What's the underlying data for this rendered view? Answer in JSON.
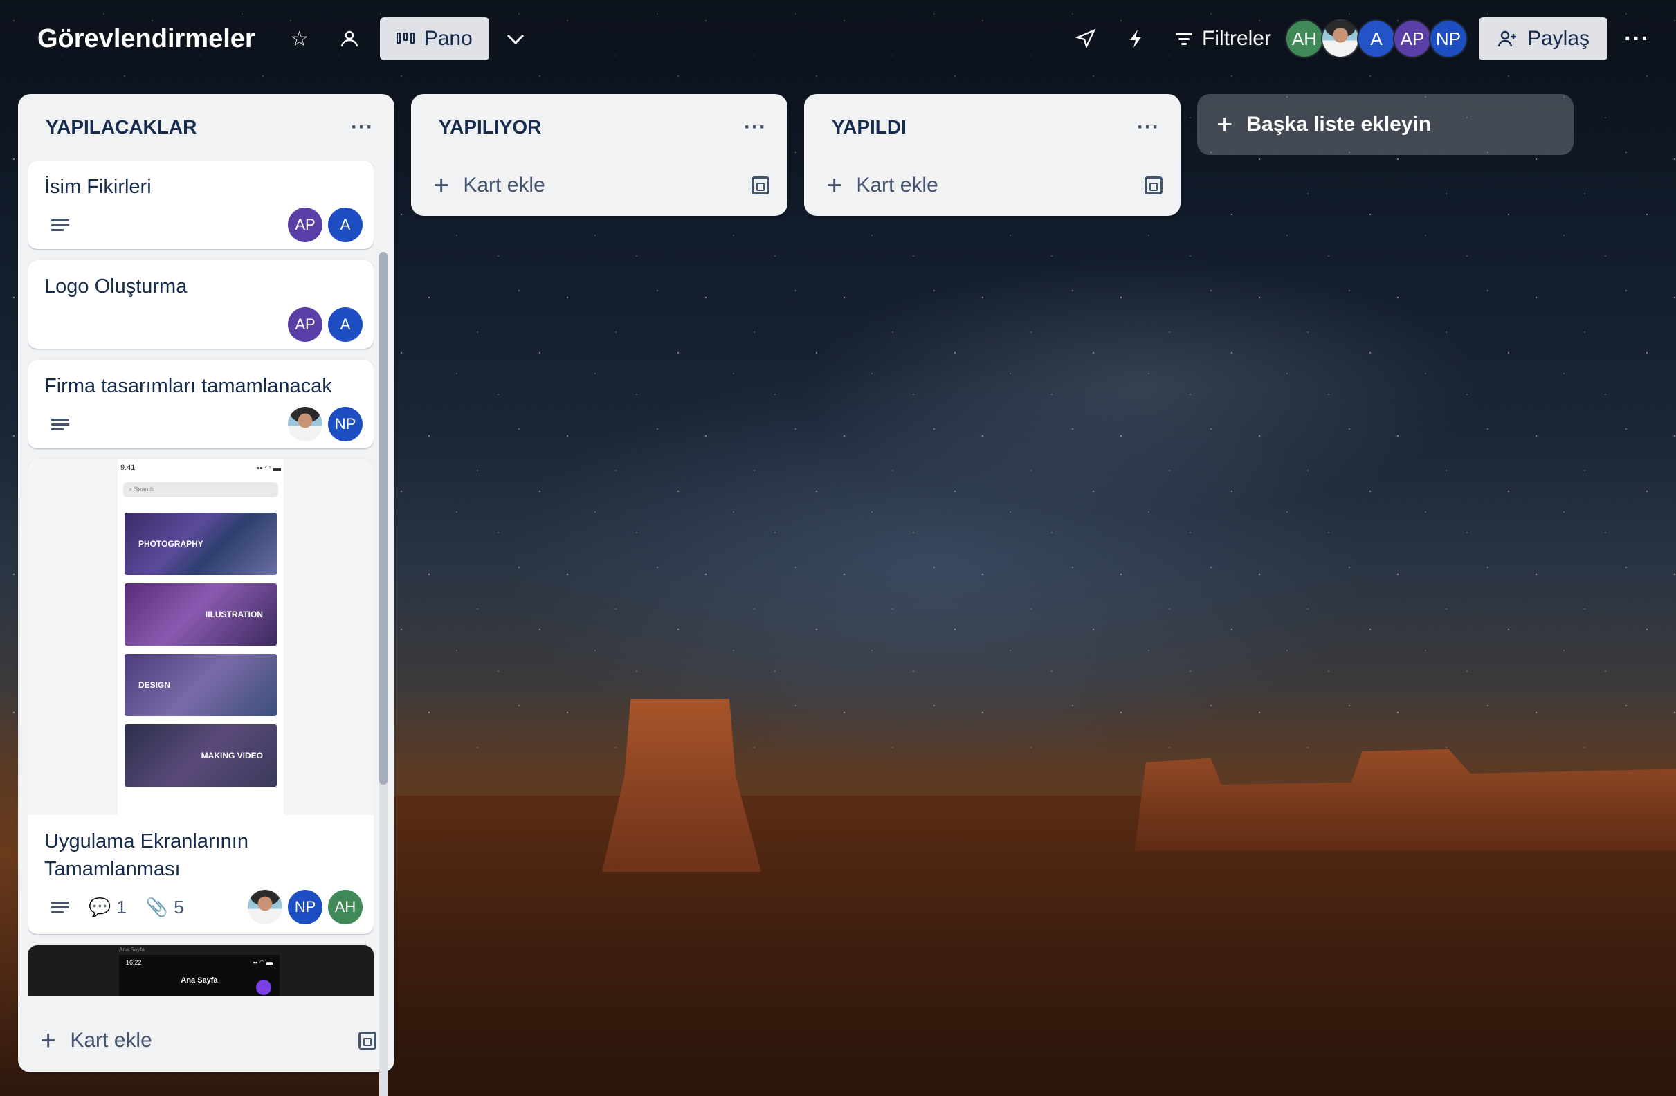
{
  "board": {
    "title": "Görevlendirmeler",
    "view_label": "Pano",
    "filter_label": "Filtreler",
    "share_label": "Paylaş",
    "members": [
      {
        "initials": "AH",
        "color": "#3f8a56"
      },
      {
        "initials": "",
        "color": "photo"
      },
      {
        "initials": "A",
        "color": "#2453c7"
      },
      {
        "initials": "AP",
        "color": "#5a3fa6"
      },
      {
        "initials": "NP",
        "color": "#1d4fc2"
      }
    ]
  },
  "lists": [
    {
      "title": "YAPILACAKLAR",
      "add_card": "Kart ekle",
      "cards": [
        {
          "title": "İsim Fikirleri",
          "members": [
            "AP",
            "A"
          ]
        },
        {
          "title": "Logo Oluşturma",
          "members": [
            "AP",
            "A"
          ]
        },
        {
          "title": "Firma tasarımları tamamlanacak",
          "members": [
            "photo",
            "NP"
          ]
        },
        {
          "title": "Uygulama Ekranlarının Tamamlanması",
          "comments": "1",
          "attachments": "5",
          "members": [
            "photo",
            "NP",
            "AH"
          ],
          "cover": {
            "time": "9:41",
            "search": "Search",
            "tiles": [
              "PHOTOGRAPHY",
              "IILUSTRATION",
              "DESIGN",
              "MAKING VIDEO"
            ]
          }
        },
        {
          "cover_dark": {
            "label": "Ana Sayfa",
            "time": "16:22",
            "title": "Ana Sayfa"
          }
        }
      ]
    },
    {
      "title": "YAPILIYOR",
      "add_card": "Kart ekle"
    },
    {
      "title": "YAPILDI",
      "add_card": "Kart ekle"
    }
  ],
  "add_list_label": "Başka liste ekleyin"
}
